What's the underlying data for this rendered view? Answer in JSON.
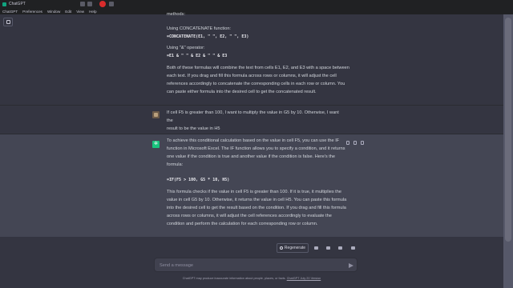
{
  "window": {
    "title": "ChatGPT"
  },
  "menu": [
    "ChatGPT",
    "Preferences",
    "Window",
    "Edit",
    "View",
    "Help"
  ],
  "top_block": {
    "lines": [
      "methods:",
      "Using CONCATENATE function:",
      "=CONCATENATE(E1, \" \", E2, \" \", E3)",
      "Using \"&\" operator:",
      "=E1 & \" \" & E2 & \" \" & E3",
      "Both of these formulas will combine the text from cells E1, E2, and E3 with a space between",
      "each text. If you drag and fill this formula across rows or columns, it will adjust the cell",
      "references accordingly to concatenate the corresponding cells in each row or column. You",
      "can paste either formula into the desired cell to get the concatenated result."
    ]
  },
  "user_message": {
    "lines": [
      "If cell F5 is greater than 100, I want to multiply the value in G5 by 10. Otherwise, I want the",
      "result to be the value in H5"
    ]
  },
  "assistant_message": {
    "lines": [
      "To achieve this conditional calculation based on the value in cell F5, you can use the IF",
      "function in Microsoft Excel. The IF function allows you to specify a condition, and it returns",
      "one value if the condition is true and another value if the condition is false. Here's the",
      "formula:",
      "=IF(F5 > 100, G5 * 10, H5)",
      "This formula checks if the value in cell F5 is greater than 100. If it is true, it multiplies the",
      "value in cell G5 by 10. Otherwise, it returns the value in cell H5. You can paste this formula",
      "into the desired cell to get the result based on the condition. If you drag and fill this formula",
      "across rows or columns, it will adjust the cell references accordingly to evaluate the",
      "condition and perform the calculation for each corresponding row or column."
    ]
  },
  "regenerate": {
    "label": "Regenerate"
  },
  "composer": {
    "placeholder": "Send a message"
  },
  "disclaimer": {
    "text": "ChatGPT may produce inaccurate information about people, places, or facts.",
    "link": "ChatGPT July 20 Version"
  },
  "colors": {
    "background": "#343541",
    "assistant_bg": "#444654",
    "accent": "#19c37d"
  }
}
